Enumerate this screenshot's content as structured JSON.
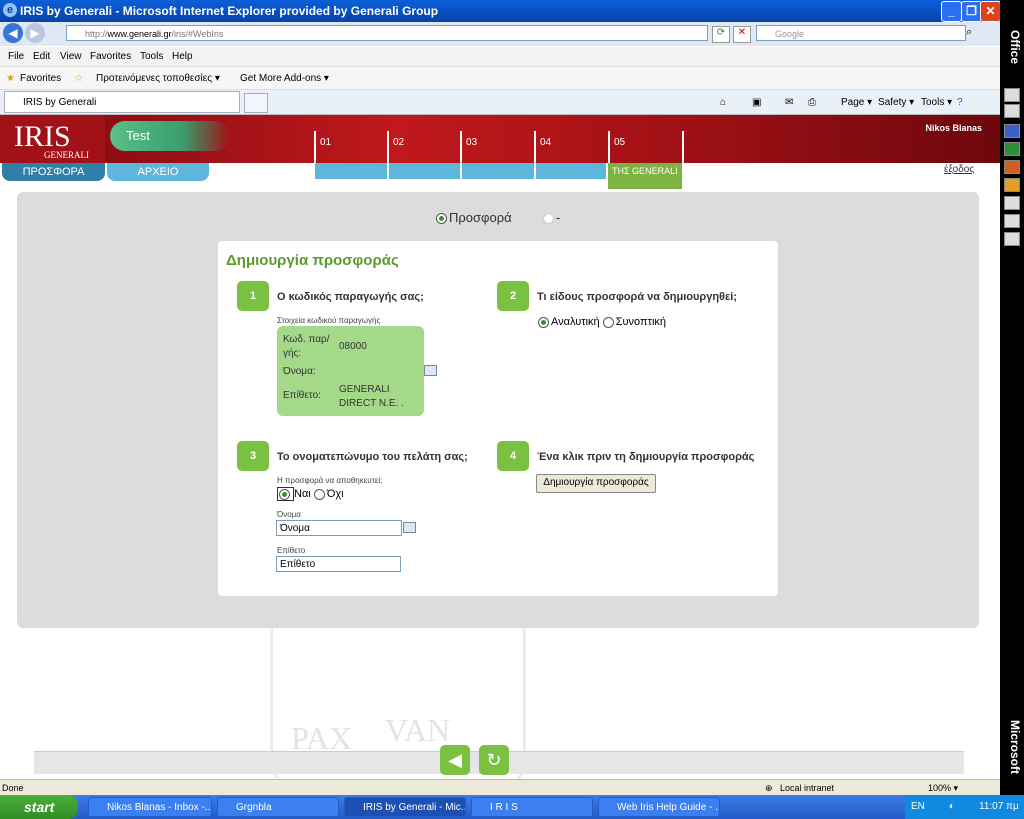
{
  "window": {
    "title": "IRIS by Generali - Microsoft Internet Explorer provided by Generali Group"
  },
  "addressbar": {
    "url_prefix": "http://",
    "url_host": "www.generali.gr",
    "url_path": "/iris/#WebIris",
    "search_placeholder": "Google"
  },
  "menu": [
    "File",
    "Edit",
    "View",
    "Favorites",
    "Tools",
    "Help"
  ],
  "favorites_bar": {
    "favorites": "Favorites",
    "suggested": "Προτεινόμενες τοποθεσίες ▾",
    "addons": "Get More Add-ons ▾"
  },
  "tab": {
    "label": "IRIS by Generali"
  },
  "commandbar": {
    "page": "Page ▾",
    "safety": "Safety ▾",
    "tools": "Tools ▾"
  },
  "app": {
    "logo_text": "IRIS",
    "logo_sub": "GENERALI",
    "test_label": "Test",
    "user_name": "Nikos Blanas",
    "steps": [
      "01",
      "02",
      "03",
      "04",
      "05"
    ],
    "tab_offer": "ΠΡΟΣΦΟΡΑ",
    "tab_archive": "ΑΡΧΕΙΟ",
    "tab_generali": "ΤΗΣ GENERALI",
    "logout": "έξοδος",
    "mode_radio_offer": "Προσφορά",
    "mode_radio_other": "-"
  },
  "form": {
    "title": "Δημιουργία προσφοράς",
    "step1": {
      "num": "1",
      "question": "Ο κωδικός παραγωγής σας;",
      "caption": "Στοιχεία κωδικού παραγωγής",
      "code_label": "Κωδ. παρ/γής:",
      "code_value": "08000",
      "name_label": "Όνομα:",
      "surname_label": "Επίθετο:",
      "surname_value": "GENERALI DIRECT N.E. ."
    },
    "step2": {
      "num": "2",
      "question": "Τι είδους προσφορά να δημιουργηθεί;",
      "opt_detailed": "Αναλυτική",
      "opt_summary": "Συνοπτική"
    },
    "step3": {
      "num": "3",
      "question": "Το ονοματεπώνυμο του πελάτη σας;",
      "save_caption": "Η προσφορά να αποθηκευτεί;",
      "yes": "Ναι",
      "no": "Όχι",
      "name_caption": "Όνομα",
      "name_value": "Όνομα",
      "surname_caption": "Επίθετο",
      "surname_value": "Επίθετο"
    },
    "step4": {
      "num": "4",
      "question": "Ένα κλικ πριν τη δημιουργία προσφοράς",
      "button": "Δημιουργία προσφοράς"
    }
  },
  "watermark": {
    "text1": "PAX",
    "text2": "VAN"
  },
  "statusbar": {
    "left": "Done",
    "zone": "Local intranet",
    "zoom": "100% ▾"
  },
  "office": {
    "top": "Office",
    "bottom": "Microsoft"
  },
  "taskbar": {
    "start": "start",
    "tasks": [
      "Nikos Blanas - Inbox -...",
      "Grgnbla",
      "IRIS by Generali - Mic...",
      "I R I S",
      "Web Iris Help Guide - ..."
    ],
    "lang": "EN",
    "clock": "11:07 πμ"
  }
}
